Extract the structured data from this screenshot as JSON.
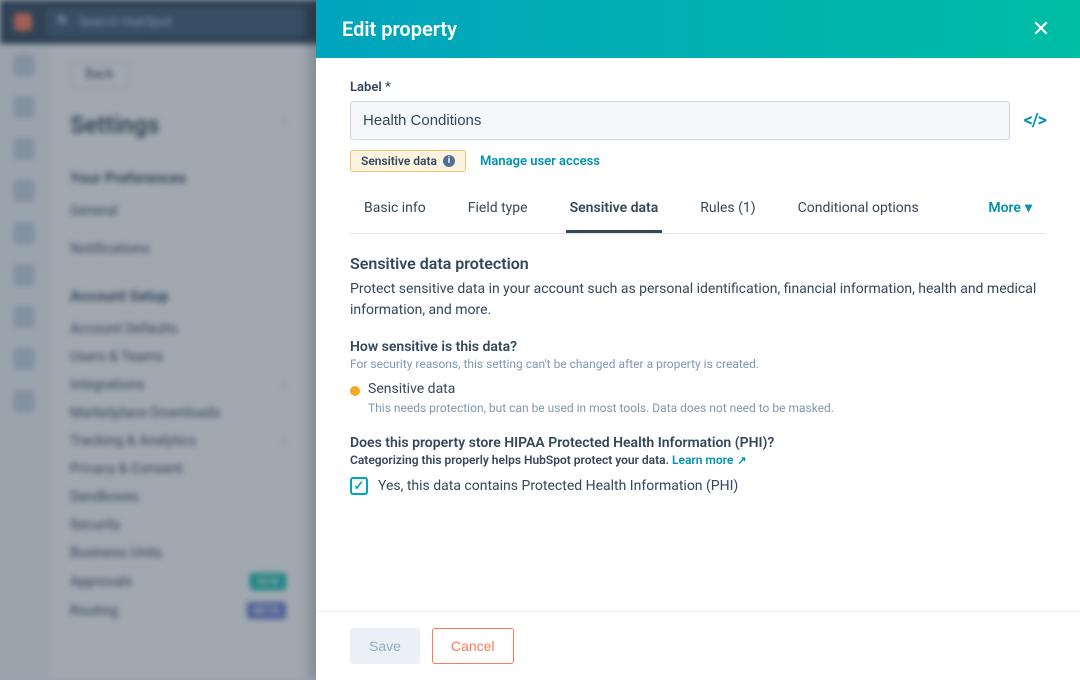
{
  "topbar": {
    "search_placeholder": "Search HubSpot"
  },
  "sidebar": {
    "back_label": "Back",
    "title": "Settings",
    "preferences_header": "Your Preferences",
    "pref_items": [
      "General",
      "Notifications"
    ],
    "account_header": "Account Setup",
    "account_items": [
      {
        "label": "Account Defaults"
      },
      {
        "label": "Users & Teams"
      },
      {
        "label": "Integrations",
        "caret": true
      },
      {
        "label": "Marketplace Downloads"
      },
      {
        "label": "Tracking & Analytics",
        "caret": true
      },
      {
        "label": "Privacy & Consent"
      },
      {
        "label": "Sandboxes"
      },
      {
        "label": "Security"
      },
      {
        "label": "Business Units"
      },
      {
        "label": "Approvals",
        "badge": "NEW",
        "badge_class": "badge-green"
      },
      {
        "label": "Routing",
        "badge": "BETA",
        "badge_class": "badge-blue"
      }
    ]
  },
  "modal": {
    "title": "Edit property",
    "label_label": "Label",
    "required_mark": "*",
    "label_value": "Health Conditions",
    "sensitive_pill": "Sensitive data",
    "manage_access": "Manage user access",
    "tabs": {
      "basic": "Basic info",
      "field": "Field type",
      "sensitive": "Sensitive data",
      "rules": "Rules (1)",
      "conditional": "Conditional options",
      "more": "More"
    },
    "section_heading": "Sensitive data protection",
    "section_desc": "Protect sensitive data in your account such as personal identification, financial information, health and medical information, and more.",
    "how_heading": "How sensitive is this data?",
    "how_note": "For security reasons, this setting can't be changed after a property is created.",
    "level_label": "Sensitive data",
    "level_desc": "This needs protection, but can be used in most tools. Data does not need to be masked.",
    "phi_heading": "Does this property store HIPAA Protected Health Information (PHI)?",
    "phi_note_prefix": "Categorizing this properly helps HubSpot protect your data. ",
    "phi_learn_more": "Learn more",
    "phi_checkbox_label": "Yes, this data contains Protected Health Information (PHI)",
    "phi_checked": true,
    "save_label": "Save",
    "cancel_label": "Cancel"
  }
}
